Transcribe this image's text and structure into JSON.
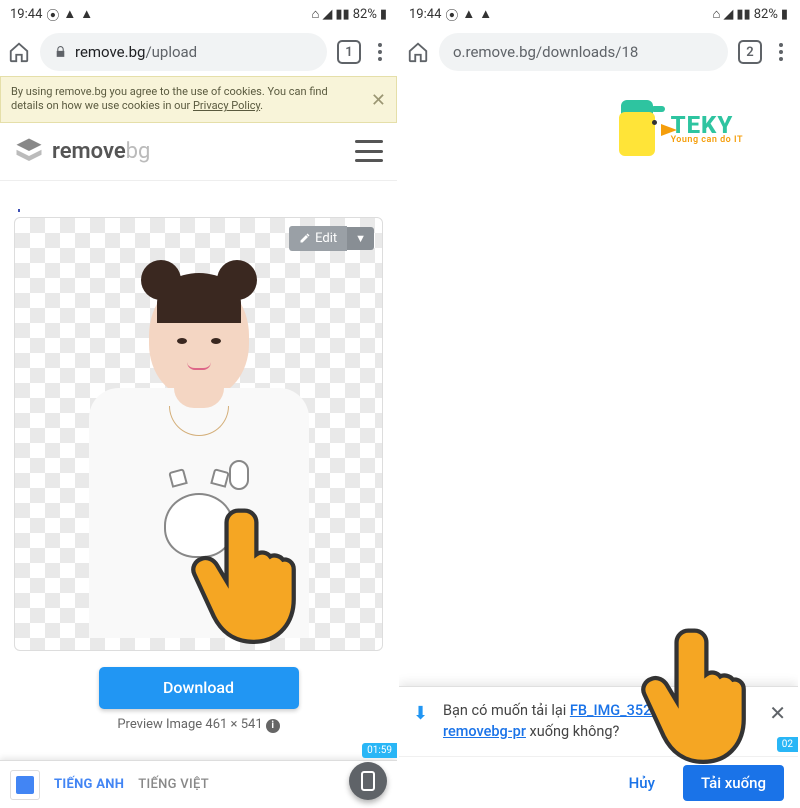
{
  "status": {
    "time": "19:44",
    "battery": "82%"
  },
  "left": {
    "url_host": "remove.bg",
    "url_path": "/upload",
    "tab_count": "1",
    "cookie_text": "By using remove.bg you agree to the use of cookies. You can find details on how we use cookies in our ",
    "cookie_link": "Privacy Policy",
    "cookie_text_end": ".",
    "logo_main": "remove",
    "logo_suffix": "bg",
    "edit_label": "Edit",
    "download_label": "Download",
    "preview_label": "Preview Image 461 × 541",
    "lang_active": "TIẾNG ANH",
    "lang_inactive": "TIẾNG VIỆT",
    "time_chip": "01:59"
  },
  "right": {
    "url_text": "o.remove.bg/downloads/18",
    "tab_count": "2",
    "teky_name": "TEKY",
    "teky_slogan": "Young can do IT",
    "prompt_pre": "Bạn có muốn tải lại ",
    "prompt_link": "FB_IMG_35296501-removebg-pr",
    "prompt_post": " xuống không?",
    "cancel_label": "Hủy",
    "download_label": "Tải xuống",
    "time_chip": "02"
  }
}
